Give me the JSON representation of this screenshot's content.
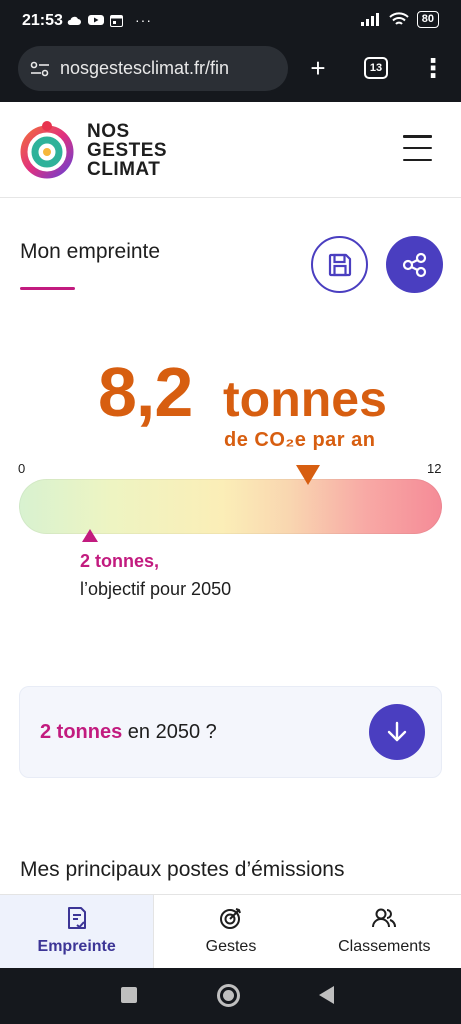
{
  "status_bar": {
    "time": "21:53",
    "battery": "80",
    "icons_left": [
      "cloud-icon",
      "youtube-icon",
      "calendar-icon",
      "more-icon"
    ],
    "icons_right": [
      "signal-icon",
      "wifi-icon",
      "battery-icon"
    ]
  },
  "browser": {
    "url": "nosgestesclimat.fr/fin",
    "tab_count": "13",
    "new_tab_label": "+",
    "menu_label": "⋮"
  },
  "header": {
    "logo_lines": [
      "NOS",
      "GESTES",
      "CLIMAT"
    ]
  },
  "result": {
    "title": "Mon empreinte",
    "value": "8,2",
    "unit": "tonnes",
    "per_year": "de CO₂e par an",
    "scale_min": "0",
    "scale_max": "12",
    "scale_min_value": 0,
    "scale_max_value": 12,
    "current_value": 8.2,
    "goal_value_num": 2,
    "goal_value": "2 tonnes,",
    "goal_caption": "l’objectif pour 2050"
  },
  "card_2050": {
    "strong": "2 tonnes",
    "rest": " en 2050 ?"
  },
  "postes": {
    "title": "Mes principaux postes d’émissions"
  },
  "bottom_nav": {
    "items": [
      {
        "label": "Empreinte",
        "icon": "footprint-doc-icon",
        "active": true
      },
      {
        "label": "Gestes",
        "icon": "target-icon",
        "active": false
      },
      {
        "label": "Classements",
        "icon": "users-icon",
        "active": false
      }
    ]
  },
  "colors": {
    "accent_purple": "#4a3ec0",
    "accent_orange": "#d75e10",
    "accent_pink": "#c21b7f"
  }
}
